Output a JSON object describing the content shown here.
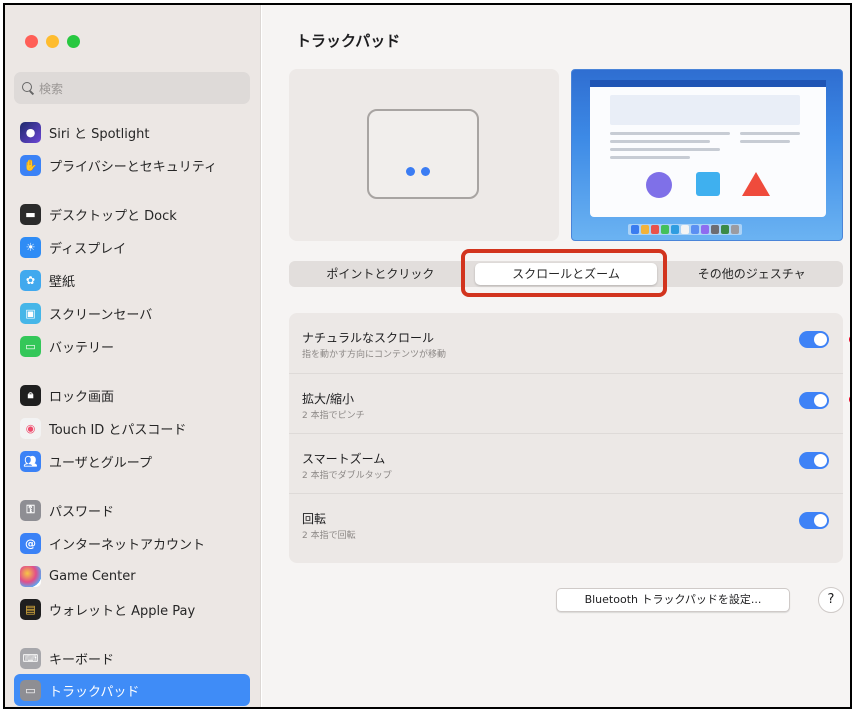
{
  "search": {
    "placeholder": "検索"
  },
  "sidebar": {
    "items": [
      {
        "label": "Siri と Spotlight",
        "icon": "siri-icon",
        "color": "#6c46d6"
      },
      {
        "label": "プライバシーとセキュリティ",
        "icon": "hand-icon",
        "color": "#3b82f6"
      },
      {
        "label": "デスクトップと Dock",
        "icon": "dock-icon",
        "color": "#2b2b2b"
      },
      {
        "label": "ディスプレイ",
        "icon": "sun-icon",
        "color": "#2f8cf5"
      },
      {
        "label": "壁紙",
        "icon": "wallpaper-icon",
        "color": "#41a9ee"
      },
      {
        "label": "スクリーンセーバ",
        "icon": "screensaver-icon",
        "color": "#46b6e8"
      },
      {
        "label": "バッテリー",
        "icon": "battery-icon",
        "color": "#34c759"
      },
      {
        "label": "ロック画面",
        "icon": "lock-icon",
        "color": "#1f1f1f"
      },
      {
        "label": "Touch ID とパスコード",
        "icon": "fingerprint-icon",
        "color": "#f0f0f0"
      },
      {
        "label": "ユーザとグループ",
        "icon": "users-icon",
        "color": "#3b82f6"
      },
      {
        "label": "パスワード",
        "icon": "key-icon",
        "color": "#8e8e93"
      },
      {
        "label": "インターネットアカウント",
        "icon": "at-icon",
        "color": "#3b82f6"
      },
      {
        "label": "Game Center",
        "icon": "game-center-icon",
        "color": "#ffffff"
      },
      {
        "label": "ウォレットと Apple Pay",
        "icon": "wallet-icon",
        "color": "#1f1f1f"
      },
      {
        "label": "キーボード",
        "icon": "keyboard-icon",
        "color": "#a7a7ab"
      },
      {
        "label": "トラックパッド",
        "icon": "trackpad-icon",
        "color": "#8e8e93"
      }
    ],
    "selected": "トラックパッド"
  },
  "main": {
    "title": "トラックパッド",
    "tabs": [
      {
        "label": "ポイントとクリック",
        "active": false
      },
      {
        "label": "スクロールとズーム",
        "active": true
      },
      {
        "label": "その他のジェスチャ",
        "active": false
      }
    ],
    "settings": [
      {
        "title": "ナチュラルなスクロール",
        "subtitle": "指を動かす方向にコンテンツが移動",
        "enabled": true
      },
      {
        "title": "拡大/縮小",
        "subtitle": "2 本指でピンチ",
        "enabled": true
      },
      {
        "title": "スマートズーム",
        "subtitle": "2 本指でダブルタップ",
        "enabled": true
      },
      {
        "title": "回転",
        "subtitle": "2 本指で回転",
        "enabled": true
      }
    ],
    "bluetooth_button": "Bluetooth トラックパッドを設定...",
    "help_button": "?"
  },
  "colors": {
    "accent": "#3e82f6",
    "highlight": "#d2341e",
    "annotation_dot": "#e8001f"
  }
}
